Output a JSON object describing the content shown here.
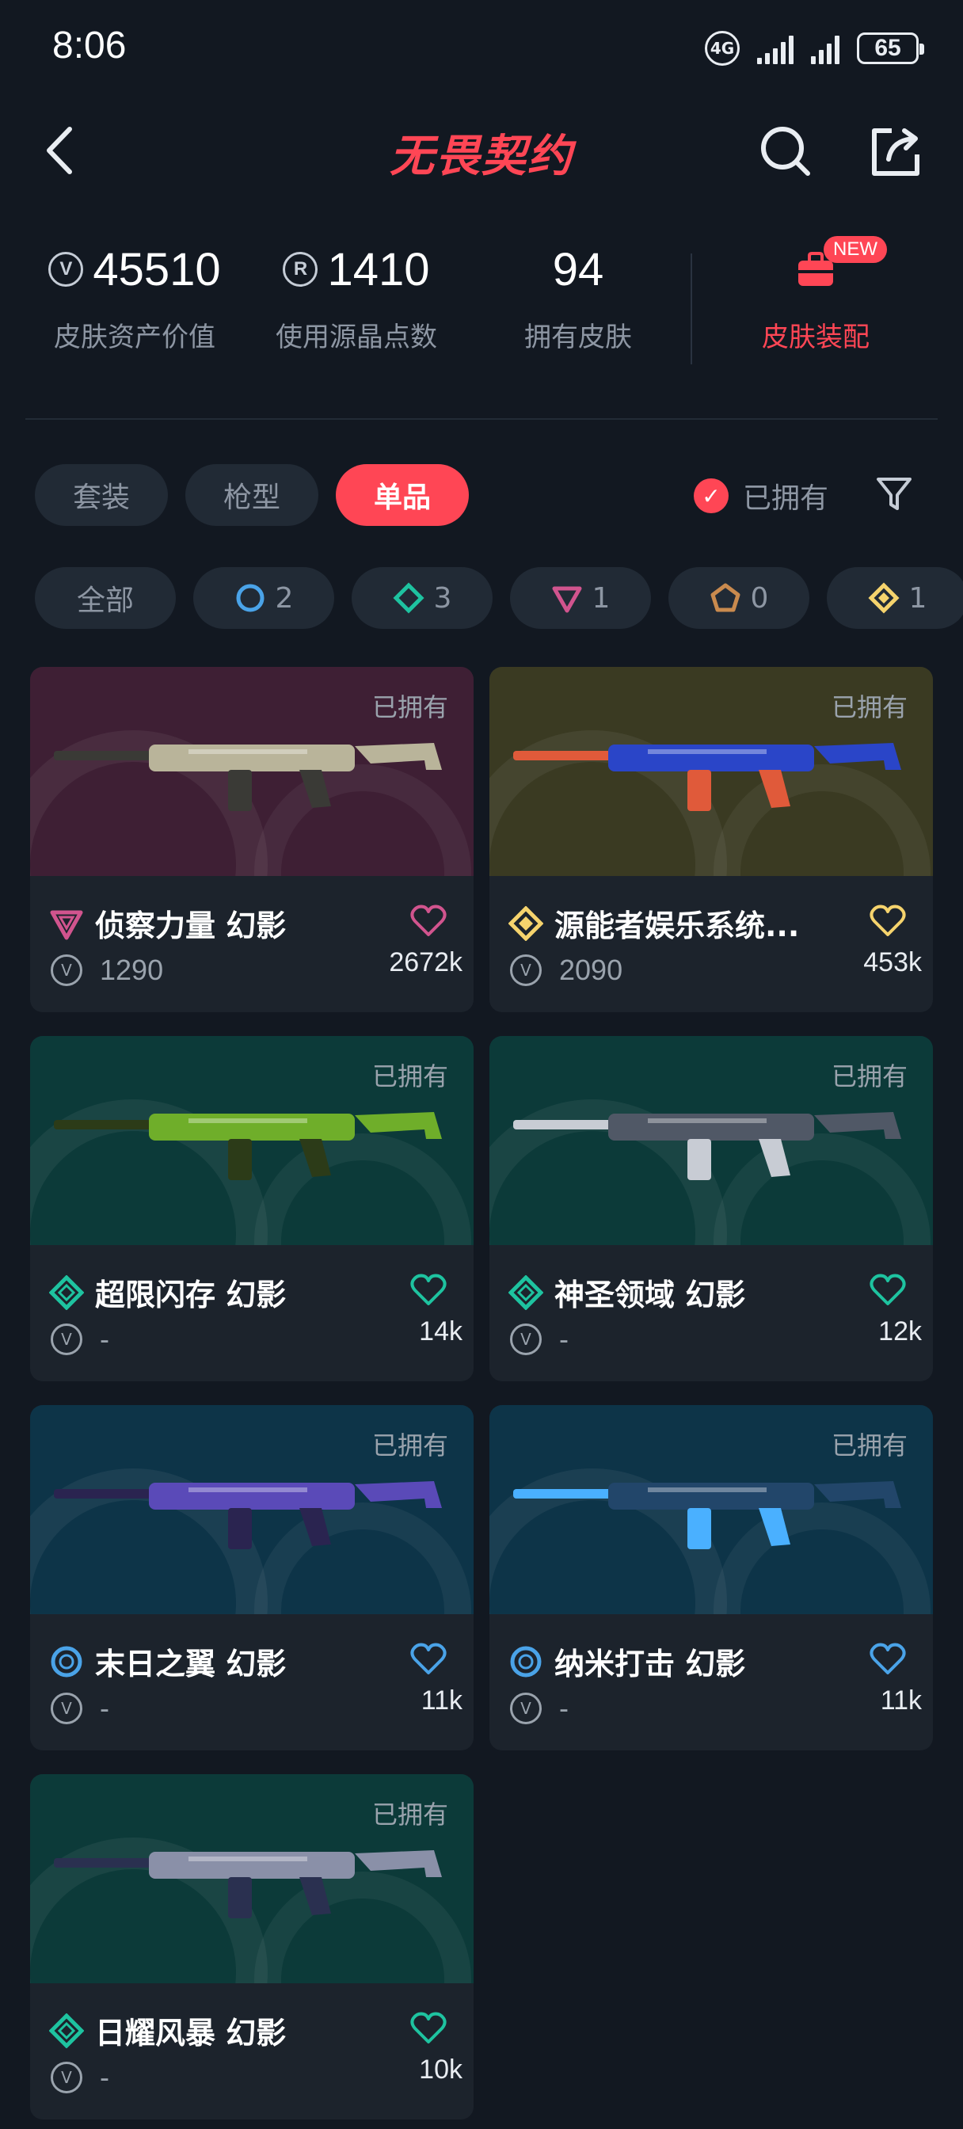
{
  "status_bar": {
    "time": "8:06",
    "battery": "65",
    "network": "4G"
  },
  "header": {
    "title": "无畏契约"
  },
  "stats": [
    {
      "value": "45510",
      "label": "皮肤资产价值",
      "icon": "vp-coin-icon"
    },
    {
      "value": "1410",
      "label": "使用源晶点数",
      "icon": "radianite-icon"
    },
    {
      "value": "94",
      "label": "拥有皮肤"
    }
  ],
  "equip": {
    "badge": "NEW",
    "label": "皮肤装配"
  },
  "tabs": [
    {
      "label": "套装",
      "active": false
    },
    {
      "label": "枪型",
      "active": false
    },
    {
      "label": "单品",
      "active": true
    }
  ],
  "owned_filter": {
    "label": "已拥有",
    "checked": true
  },
  "rarity_chips": [
    {
      "label": "全部"
    },
    {
      "count": "2",
      "tier": "select",
      "color": "#4aa3e8"
    },
    {
      "count": "3",
      "tier": "deluxe",
      "color": "#1ec3a0"
    },
    {
      "count": "1",
      "tier": "premium",
      "color": "#d1548e"
    },
    {
      "count": "0",
      "tier": "ultra",
      "color": "#c98a4e"
    },
    {
      "count": "1",
      "tier": "exclusive",
      "color": "#f5d36d"
    }
  ],
  "skins": [
    {
      "name": "侦察力量 幻影",
      "owned": "已拥有",
      "price": "1290",
      "likes": "2672k",
      "tier_color": "#d1548e",
      "heart_color": "#d1548e",
      "bg": "#3e1f34"
    },
    {
      "name": "源能者娱乐系统...",
      "owned": "已拥有",
      "price": "2090",
      "likes": "453k",
      "tier_color": "#f5d36d",
      "heart_color": "#f5d36d",
      "bg": "#3a3a22"
    },
    {
      "name": "超限闪存 幻影",
      "owned": "已拥有",
      "price": "-",
      "likes": "14k",
      "tier_color": "#1ec3a0",
      "heart_color": "#1ec3a0",
      "bg": "#0c3a39"
    },
    {
      "name": "神圣领域 幻影",
      "owned": "已拥有",
      "price": "-",
      "likes": "12k",
      "tier_color": "#1ec3a0",
      "heart_color": "#1ec3a0",
      "bg": "#0c3a39"
    },
    {
      "name": "末日之翼 幻影",
      "owned": "已拥有",
      "price": "-",
      "likes": "11k",
      "tier_color": "#4aa3e8",
      "heart_color": "#4aa3e8",
      "bg": "#0d3448"
    },
    {
      "name": "纳米打击 幻影",
      "owned": "已拥有",
      "price": "-",
      "likes": "11k",
      "tier_color": "#4aa3e8",
      "heart_color": "#4aa3e8",
      "bg": "#0d3448"
    },
    {
      "name": "日耀风暴 幻影",
      "owned": "已拥有",
      "price": "-",
      "likes": "10k",
      "tier_color": "#1ec3a0",
      "heart_color": "#1ec3a0",
      "bg": "#0c3a39"
    }
  ]
}
